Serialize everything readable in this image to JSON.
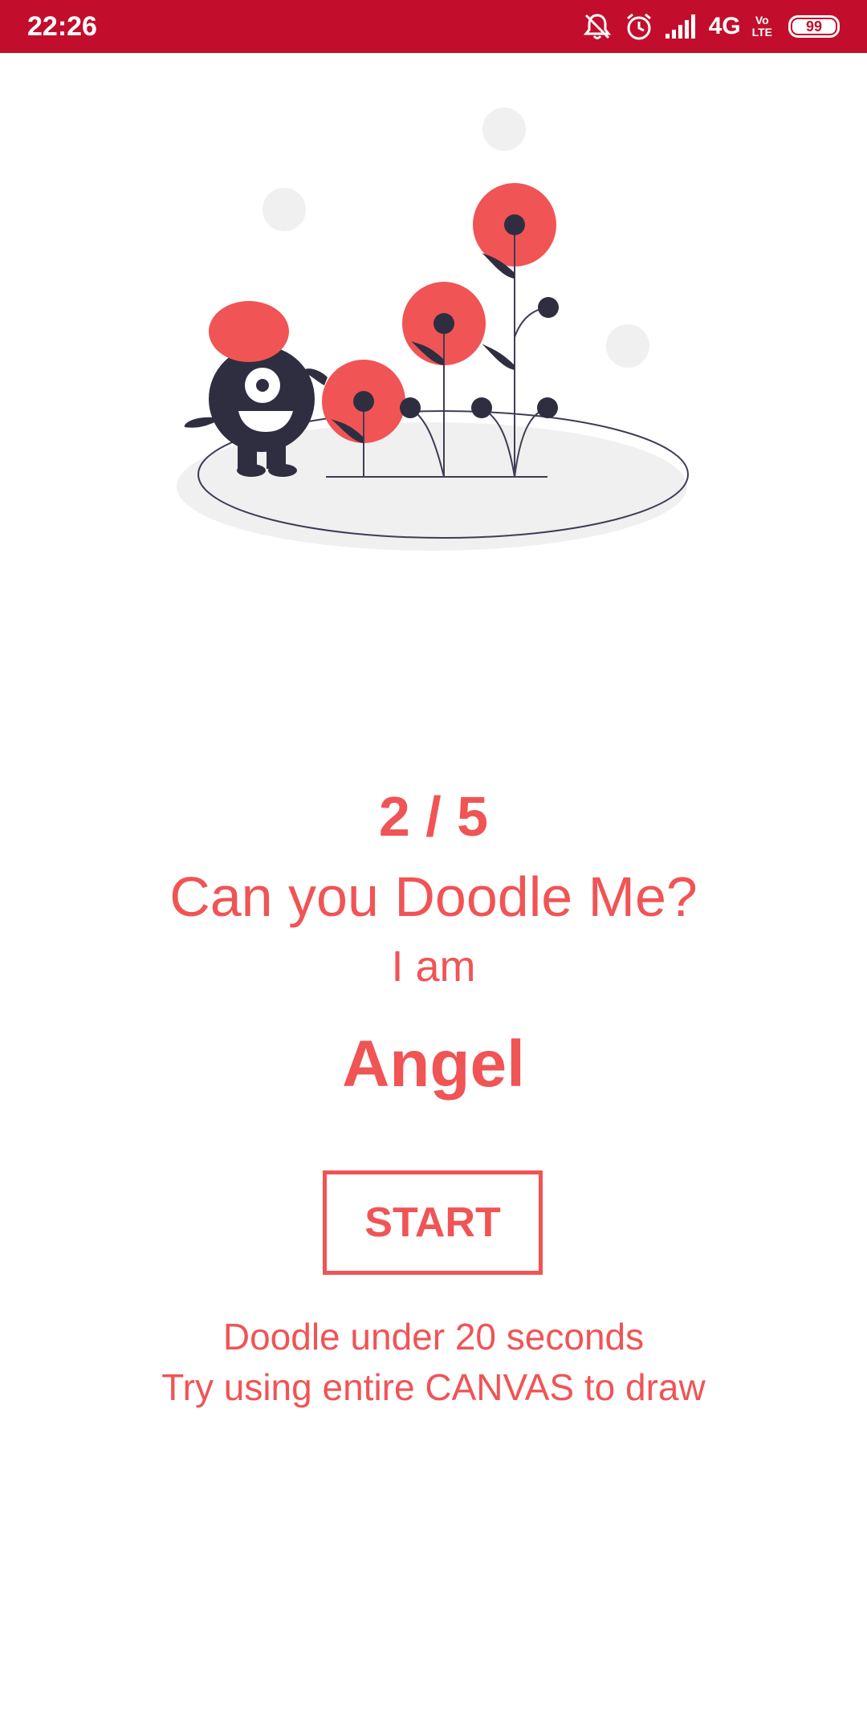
{
  "status_bar": {
    "time": "22:26",
    "network": "4G",
    "volte_top": "Vo",
    "volte_bottom": "LTE",
    "battery": "99",
    "icons": [
      "mute-notifications-icon",
      "alarm-icon",
      "signal-icon",
      "battery-icon"
    ],
    "background": "#c20e2c"
  },
  "illustration": {
    "icon": "doodle-monster-garden-illustration",
    "accent": "#f05455",
    "dark": "#2f2e41"
  },
  "game": {
    "progress": "2 / 5",
    "question": "Can you Doodle Me?",
    "intro": "I am",
    "word": "Angel",
    "start_label": "START",
    "hint_1": "Doodle under 20 seconds",
    "hint_2": "Try using entire CANVAS to draw"
  },
  "theme": {
    "accent": "#f05455",
    "background": "#ffffff"
  }
}
